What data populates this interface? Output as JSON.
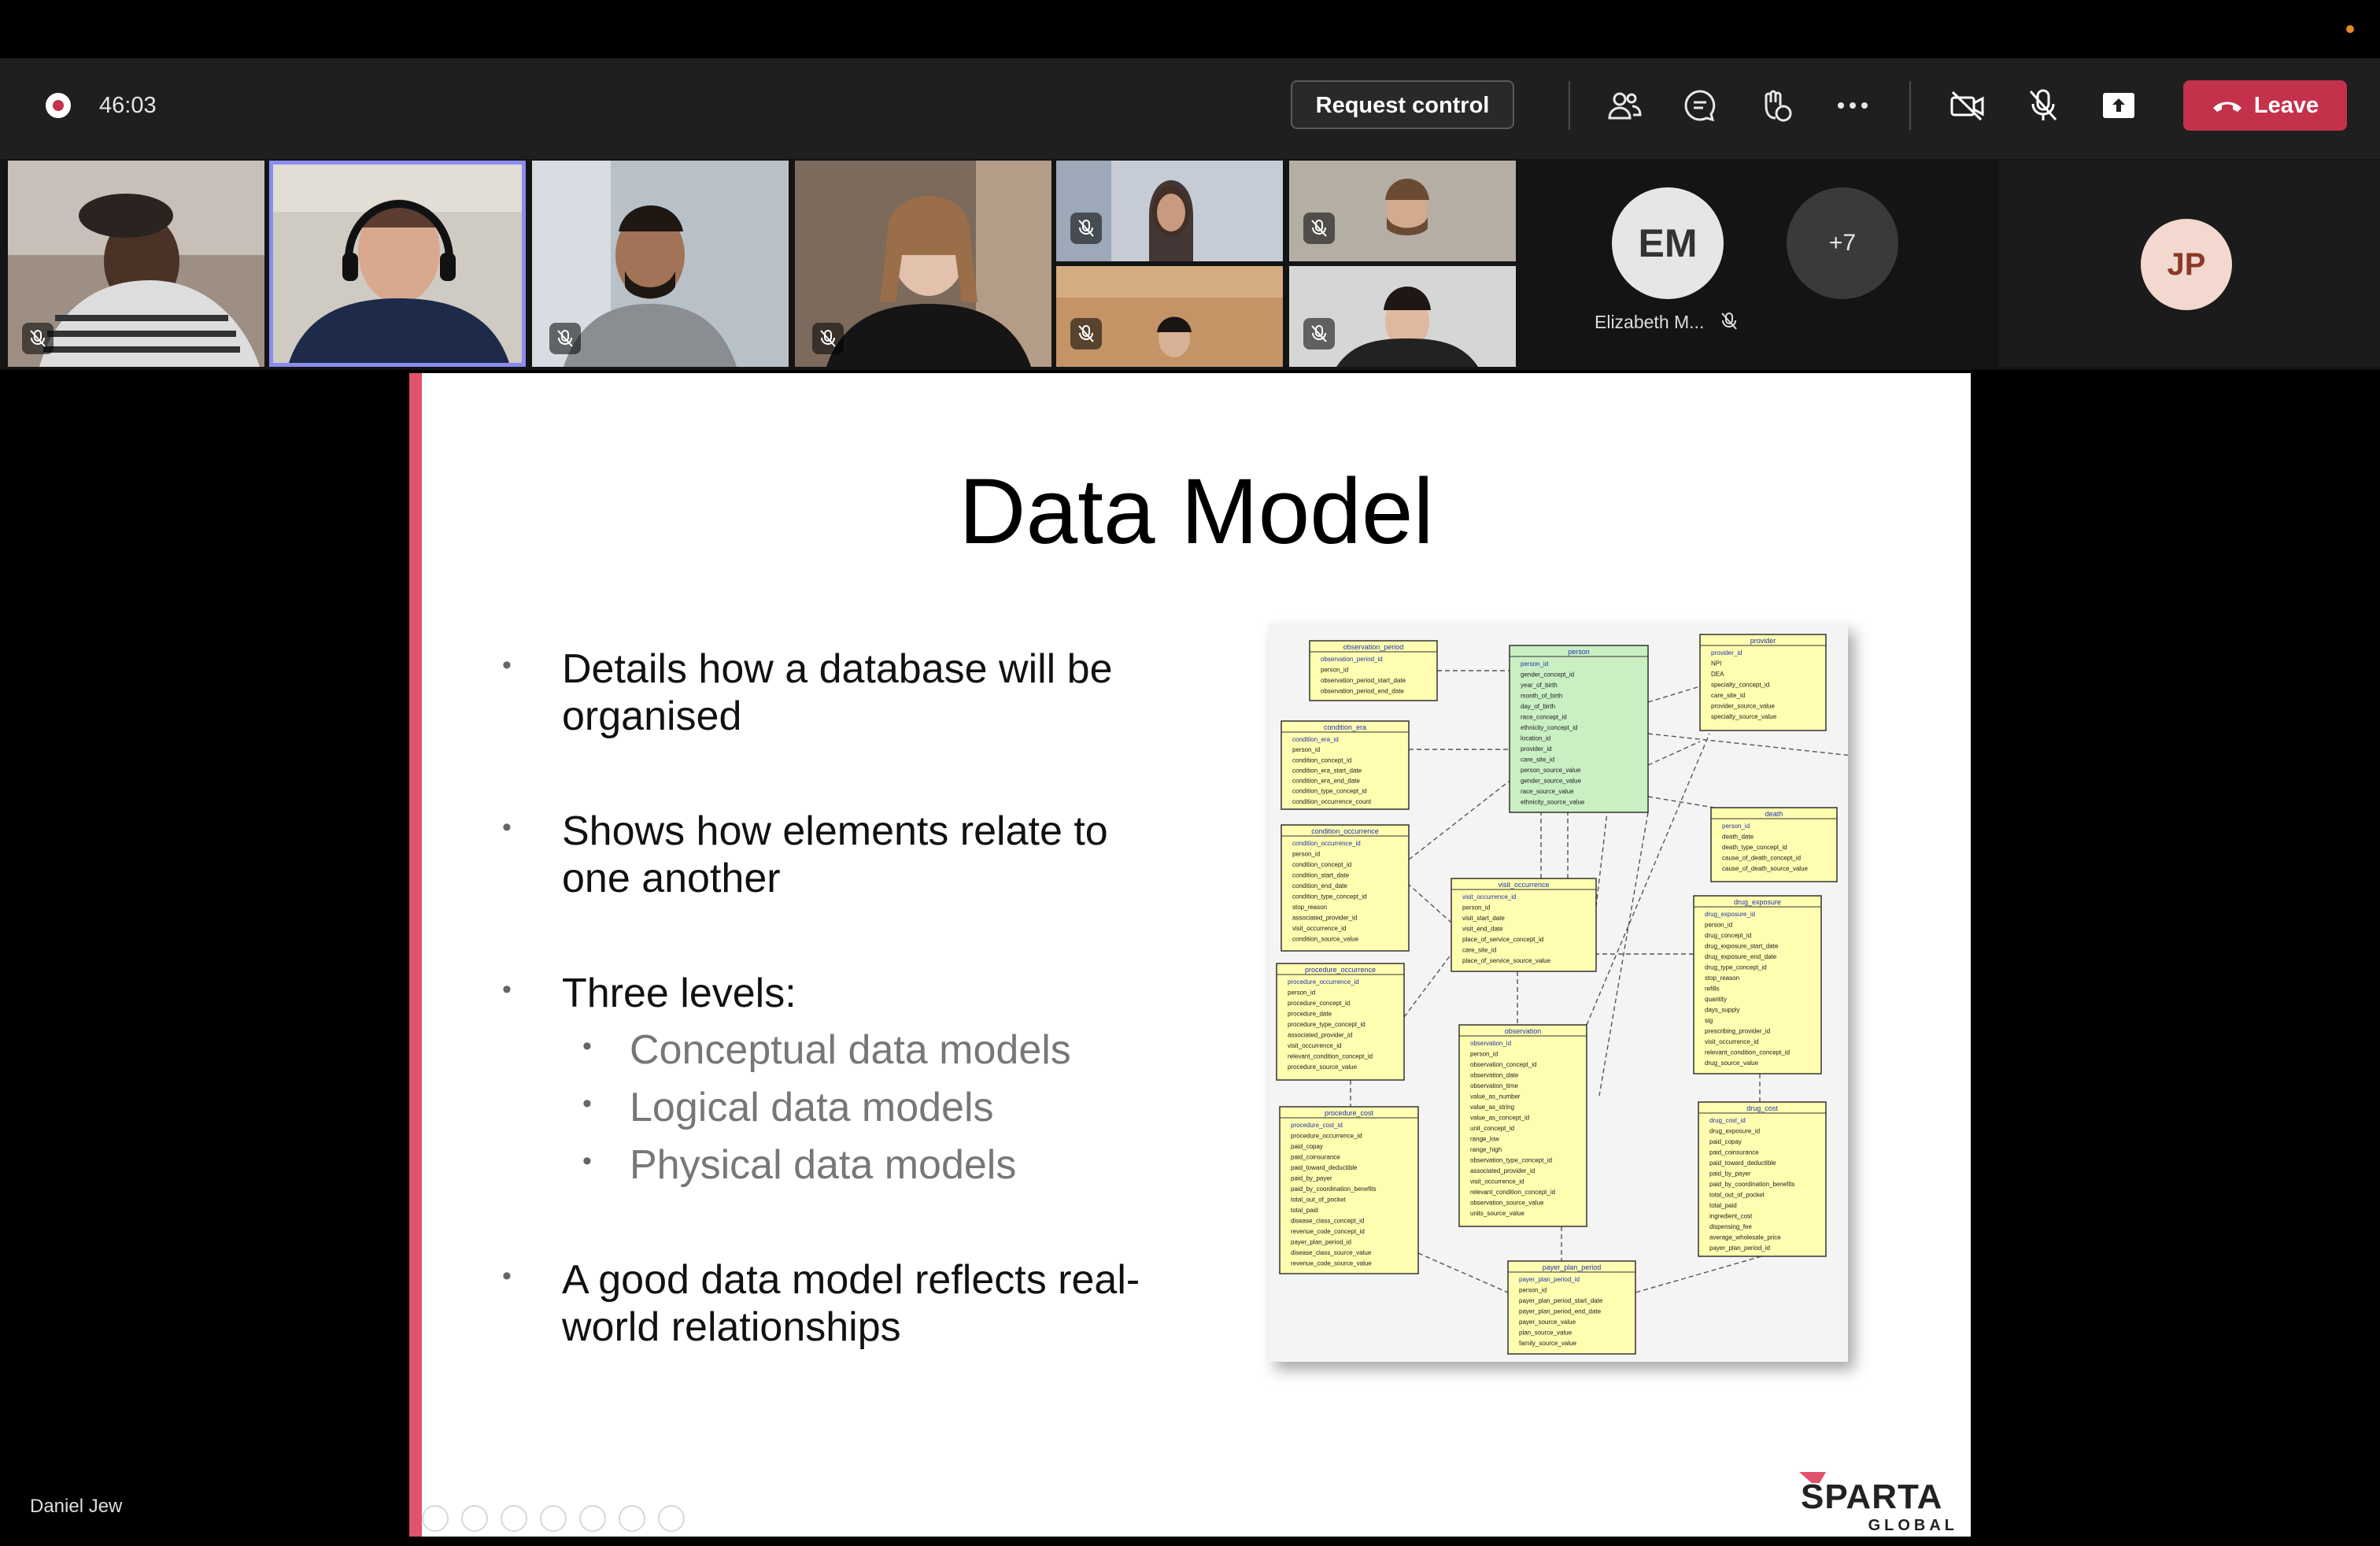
{
  "meeting": {
    "timer": "46:03",
    "request_control_label": "Request control",
    "leave_label": "Leave"
  },
  "participants": {
    "em": {
      "initials": "EM",
      "name": "Elizabeth M..."
    },
    "more": {
      "label": "+7"
    },
    "jp": {
      "initials": "JP"
    }
  },
  "presenter": {
    "name": "Daniel Jew"
  },
  "slide": {
    "title": "Data Model",
    "bullets": [
      {
        "line1": "Details how a database will be",
        "line2": "organised"
      },
      {
        "line1": "Shows how elements relate to",
        "line2": "one another"
      },
      {
        "line1": "Three levels:"
      },
      {
        "line1": "A good data model reflects real-",
        "line2": "world relationships"
      }
    ],
    "sub_bullets": [
      "Conceptual data models",
      "Logical data models",
      "Physical data models"
    ],
    "logo": {
      "word1": "SPARTA",
      "word2": "GLOBAL"
    }
  },
  "erd": {
    "tables": [
      {
        "name": "observation_period",
        "fields": [
          "observation_period_id",
          "person_id",
          "observation_period_start_date",
          "observation_period_end_date"
        ]
      },
      {
        "name": "person",
        "fields": [
          "person_id",
          "gender_concept_id",
          "year_of_birth",
          "month_of_birth",
          "day_of_birth",
          "race_concept_id",
          "ethnicity_concept_id",
          "location_id",
          "provider_id",
          "care_site_id",
          "person_source_value",
          "gender_source_value",
          "race_source_value",
          "ethnicity_source_value"
        ]
      },
      {
        "name": "provider",
        "fields": [
          "provider_id",
          "NPI",
          "DEA",
          "specialty_concept_id",
          "care_site_id",
          "provider_source_value",
          "specialty_source_value"
        ]
      },
      {
        "name": "condition_era",
        "fields": [
          "condition_era_id",
          "person_id",
          "condition_concept_id",
          "condition_era_start_date",
          "condition_era_end_date",
          "condition_type_concept_id",
          "condition_occurrence_count"
        ]
      },
      {
        "name": "death",
        "fields": [
          "person_id",
          "death_date",
          "death_type_concept_id",
          "cause_of_death_concept_id",
          "cause_of_death_source_value"
        ]
      },
      {
        "name": "condition_occurrence",
        "fields": [
          "condition_occurrence_id",
          "person_id",
          "condition_concept_id",
          "condition_start_date",
          "condition_end_date",
          "condition_type_concept_id",
          "stop_reason",
          "associated_provider_id",
          "visit_occurrence_id",
          "condition_source_value"
        ]
      },
      {
        "name": "visit_occurrence",
        "fields": [
          "visit_occurrence_id",
          "person_id",
          "visit_start_date",
          "visit_end_date",
          "place_of_service_concept_id",
          "care_site_id",
          "place_of_service_source_value"
        ]
      },
      {
        "name": "drug_exposure",
        "fields": [
          "drug_exposure_id",
          "person_id",
          "drug_concept_id",
          "drug_exposure_start_date",
          "drug_exposure_end_date",
          "drug_type_concept_id",
          "stop_reason",
          "refills",
          "quantity",
          "days_supply",
          "sig",
          "prescribing_provider_id",
          "visit_occurrence_id",
          "relevant_condition_concept_id",
          "drug_source_value"
        ]
      },
      {
        "name": "procedure_occurrence",
        "fields": [
          "procedure_occurrence_id",
          "person_id",
          "procedure_concept_id",
          "procedure_date",
          "procedure_type_concept_id",
          "associated_provider_id",
          "visit_occurrence_id",
          "relevant_condition_concept_id",
          "procedure_source_value"
        ]
      },
      {
        "name": "observation",
        "fields": [
          "observation_id",
          "person_id",
          "observation_concept_id",
          "observation_date",
          "observation_time",
          "value_as_number",
          "value_as_string",
          "value_as_concept_id",
          "unit_concept_id",
          "range_low",
          "range_high",
          "observation_type_concept_id",
          "associated_provider_id",
          "visit_occurrence_id",
          "relevant_condition_concept_id",
          "observation_source_value",
          "units_source_value"
        ]
      },
      {
        "name": "procedure_cost",
        "fields": [
          "procedure_cost_id",
          "procedure_occurrence_id",
          "paid_copay",
          "paid_coinsurance",
          "paid_toward_deductible",
          "paid_by_payer",
          "paid_by_coordination_benefits",
          "total_out_of_pocket",
          "total_paid",
          "disease_class_concept_id",
          "revenue_code_concept_id",
          "payer_plan_period_id",
          "disease_class_source_value",
          "revenue_code_source_value"
        ]
      },
      {
        "name": "drug_cost",
        "fields": [
          "drug_cost_id",
          "drug_exposure_id",
          "paid_copay",
          "paid_coinsurance",
          "paid_toward_deductible",
          "paid_by_payer",
          "paid_by_coordination_benefits",
          "total_out_of_pocket",
          "total_paid",
          "ingredient_cost",
          "dispensing_fee",
          "average_wholesale_price",
          "payer_plan_period_id"
        ]
      },
      {
        "name": "payer_plan_period",
        "fields": [
          "payer_plan_period_id",
          "person_id",
          "payer_plan_period_start_date",
          "payer_plan_period_end_date",
          "payer_source_value",
          "plan_source_value",
          "family_source_value"
        ]
      }
    ]
  }
}
